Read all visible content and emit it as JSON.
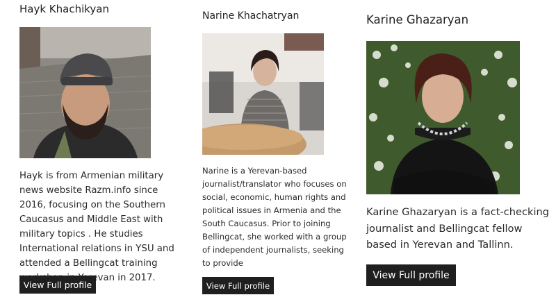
{
  "profiles": [
    {
      "name": "Hayk Khachikyan",
      "bio": "Hayk is from Armenian military news website Razm.info since 2016, focusing on the Southern Caucasus and Middle East with military topics . He studies International relations in YSU and attended a Bellingcat training workshop in Yerevan in 2017.",
      "button_label": "View Full profile"
    },
    {
      "name": "Narine Khachatryan",
      "bio": "Narine is a Yerevan-based journalist/translator who focuses on social, economic, human rights and political issues in Armenia and the South Caucasus. Prior to joining Bellingcat, she worked with a group of independent journalists, seeking to provide",
      "button_label": "View Full profile"
    },
    {
      "name": "Karine Ghazaryan",
      "bio": "Karine Ghazaryan is a fact-checking journalist and Bellingcat fellow based in Yerevan and Tallinn.",
      "button_label": "View Full profile"
    }
  ],
  "colors": {
    "button_bg": "#1f1f1f",
    "button_text": "#ffffff",
    "text": "#222222"
  }
}
